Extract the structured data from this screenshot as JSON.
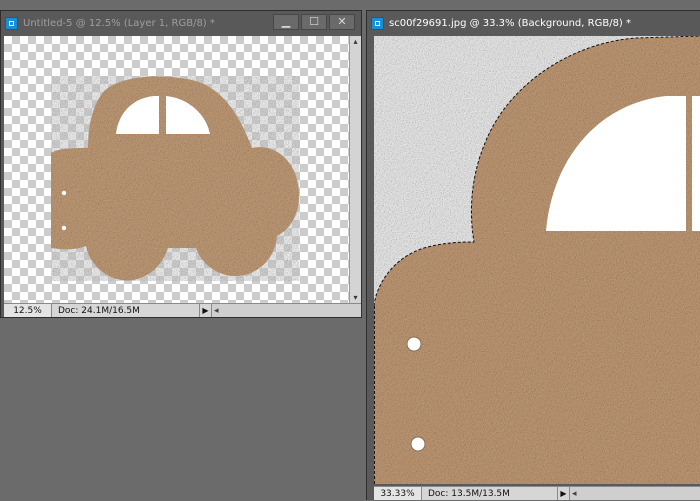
{
  "windows": [
    {
      "title": "Untitled-5 @ 12.5% (Layer 1, RGB/8) *",
      "zoom": "12.5%",
      "doc": "Doc: 24.1M/16.5M",
      "active": false
    },
    {
      "title": "sc00f29691.jpg @ 33.3% (Background, RGB/8) *",
      "zoom": "33.33%",
      "doc": "Doc: 13.5M/13.5M",
      "active": true
    }
  ],
  "controls": {
    "minimize": "▁",
    "maximize": "☐",
    "close": "✕"
  },
  "icons": {
    "app": "photoshop-document-icon",
    "status_arrow": "triangle-right-icon",
    "scroll_left": "scroll-left-icon",
    "scroll_up": "scroll-up-icon",
    "scroll_down": "scroll-down-icon"
  },
  "colors": {
    "workspace": "#6b6b6b",
    "cardboard": "#c8a07a",
    "transparency_checker": "#cccccc"
  }
}
